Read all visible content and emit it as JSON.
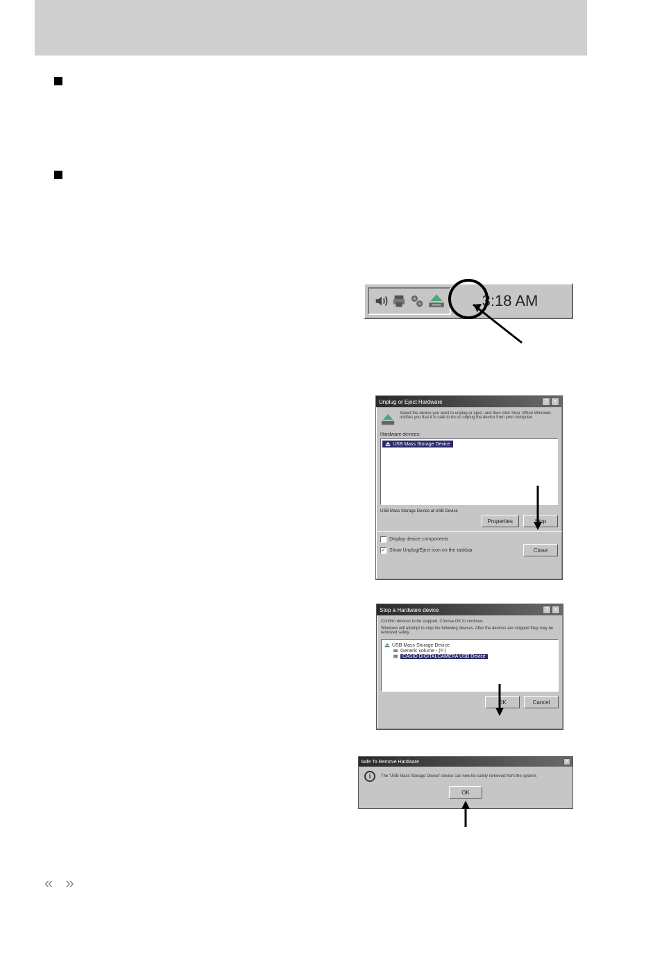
{
  "tray": {
    "icons": [
      "volume-icon",
      "printer-icon",
      "network-icon",
      "eject-hardware-icon"
    ],
    "clock": "3:18 AM"
  },
  "unplug_dialog": {
    "title": "Unplug or Eject Hardware",
    "intro": "Select the device you want to unplug or eject, and then click Stop. When Windows notifies you that it is safe to do so unplug the device from your computer.",
    "list_label": "Hardware devices:",
    "device": "USB Mass Storage Device",
    "status_line": "USB Mass Storage Device at USB Device",
    "properties_btn": "Properties",
    "stop_btn": "Stop",
    "cb1": "Display device components",
    "cb2": "Show Unplug/Eject icon on the taskbar",
    "close_btn": "Close"
  },
  "stop_dialog": {
    "title": "Stop a Hardware device",
    "line1": "Confirm devices to be stopped. Choose OK to continue.",
    "line2": "Windows will attempt to stop the following devices. After the devices are stopped they may be removed safely.",
    "tree_root": "USB Mass Storage Device",
    "tree_child1": "Generic volume - (F:)",
    "tree_child2": "CASIO DIGITALCAMERA USB Device",
    "ok_btn": "OK",
    "cancel_btn": "Cancel"
  },
  "safe_dialog": {
    "title": "Safe To Remove Hardware",
    "message": "The 'USB Mass Storage Device' device can now be safely removed from the system.",
    "ok_btn": "OK"
  },
  "page_nav": "«    »"
}
